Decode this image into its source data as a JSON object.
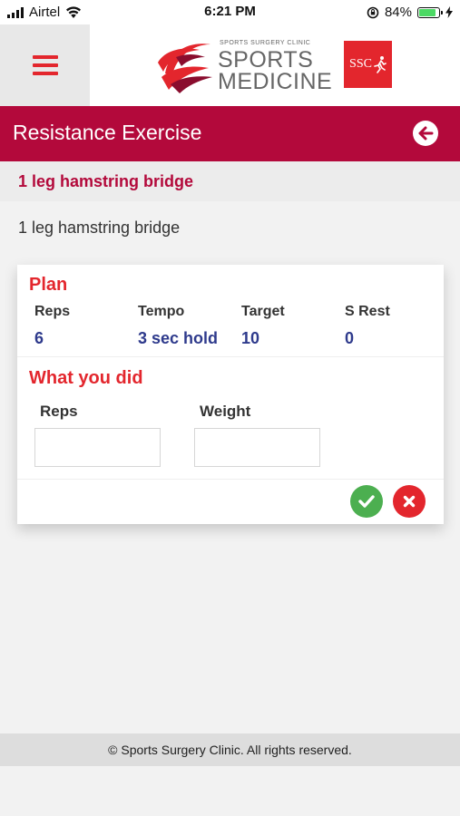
{
  "status_bar": {
    "carrier": "Airtel",
    "time": "6:21 PM",
    "battery_percent": "84%",
    "battery_level": 0.84,
    "icons": [
      "signal-icon",
      "wifi-icon",
      "rotation-lock-icon",
      "battery-icon",
      "charging-bolt-icon"
    ]
  },
  "header": {
    "menu_icon": "hamburger-icon",
    "logo": {
      "small_text": "SPORTS SURGERY CLINIC",
      "line1": "SPORTS",
      "line2": "MEDICINE",
      "badge": "SSC"
    }
  },
  "title_bar": {
    "title": "Resistance Exercise",
    "back_icon": "back-arrow-icon"
  },
  "exercise": {
    "heading": "1 leg hamstring bridge",
    "description": "1 leg hamstring bridge"
  },
  "plan": {
    "title": "Plan",
    "columns": [
      {
        "label": "Reps",
        "value": "6"
      },
      {
        "label": "Tempo",
        "value": "3 sec hold"
      },
      {
        "label": "Target",
        "value": "10"
      },
      {
        "label": "S Rest",
        "value": "0"
      }
    ]
  },
  "what_you_did": {
    "title": "What you did",
    "fields": [
      {
        "label": "Reps",
        "value": ""
      },
      {
        "label": "Weight",
        "value": ""
      }
    ]
  },
  "actions": {
    "confirm_icon": "check-icon",
    "cancel_icon": "close-icon"
  },
  "footer": {
    "text": "© Sports Surgery Clinic. All rights reserved."
  },
  "colors": {
    "brand_red": "#e3262d",
    "title_bar": "#b3093b",
    "value_blue": "#2e3a8c",
    "confirm_green": "#4caf50"
  }
}
